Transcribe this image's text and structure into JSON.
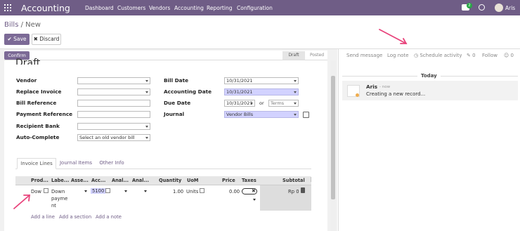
{
  "app": {
    "title": "Accounting",
    "user_name": "Aris",
    "messages_badge": "2"
  },
  "nav": [
    "Dashboard",
    "Customers",
    "Vendors",
    "Accounting",
    "Reporting",
    "Configuration"
  ],
  "breadcrumb": {
    "parent": "Bills",
    "current": "New"
  },
  "control": {
    "save_label": "Save",
    "discard_label": "Discard"
  },
  "statusbar": {
    "confirm_label": "Confirm",
    "stages": [
      "Draft",
      "Posted"
    ],
    "active_stage": "Draft"
  },
  "form": {
    "title": "Draft",
    "left_fields": [
      {
        "label": "Vendor",
        "value": ""
      },
      {
        "label": "Replace Invoice",
        "value": ""
      },
      {
        "label": "Bill Reference",
        "value": ""
      },
      {
        "label": "Payment Reference",
        "value": ""
      },
      {
        "label": "Recipient Bank",
        "value": ""
      },
      {
        "label": "Auto-Complete",
        "value": "Select an old vendor bill"
      }
    ],
    "right_fields": {
      "bill_date_label": "Bill Date",
      "bill_date": "10/31/2021",
      "accounting_date_label": "Accounting Date",
      "accounting_date": "10/31/2021",
      "due_date_label": "Due Date",
      "due_date": "10/31/2021",
      "or_text": "or",
      "terms_placeholder": "Terms",
      "journal_label": "Journal",
      "journal": "Vendor Bills"
    }
  },
  "tabs": [
    "Invoice Lines",
    "Journal Items",
    "Other Info"
  ],
  "lines_table": {
    "headers": [
      "Prod...",
      "Labe...",
      "Asse...",
      "Acc...",
      "Anal...",
      "Anal...",
      "Quantity",
      "UoM",
      "Price",
      "Taxes",
      "Subtotal"
    ],
    "row": {
      "product": "Dow",
      "label_lines": [
        "Down",
        "payme",
        "nt"
      ],
      "account": "5100",
      "quantity": "1.00",
      "uom": "Units",
      "price": "0.00",
      "subtotal": "Rp 0"
    },
    "add_links": [
      "Add a line",
      "Add a section",
      "Add a note"
    ]
  },
  "chatter": {
    "send_message": "Send message",
    "log_note": "Log note",
    "schedule_activity": "Schedule activity",
    "attachments_count": "0",
    "follow": "Follow",
    "followers_count": "0",
    "date_separator": "Today",
    "message": {
      "author": "Aris",
      "time": "- now",
      "body": "Creating a new record..."
    }
  },
  "colors": {
    "brand": "#6f5d86",
    "annotation": "#e8437b",
    "required_field": "#d2d2ff"
  }
}
